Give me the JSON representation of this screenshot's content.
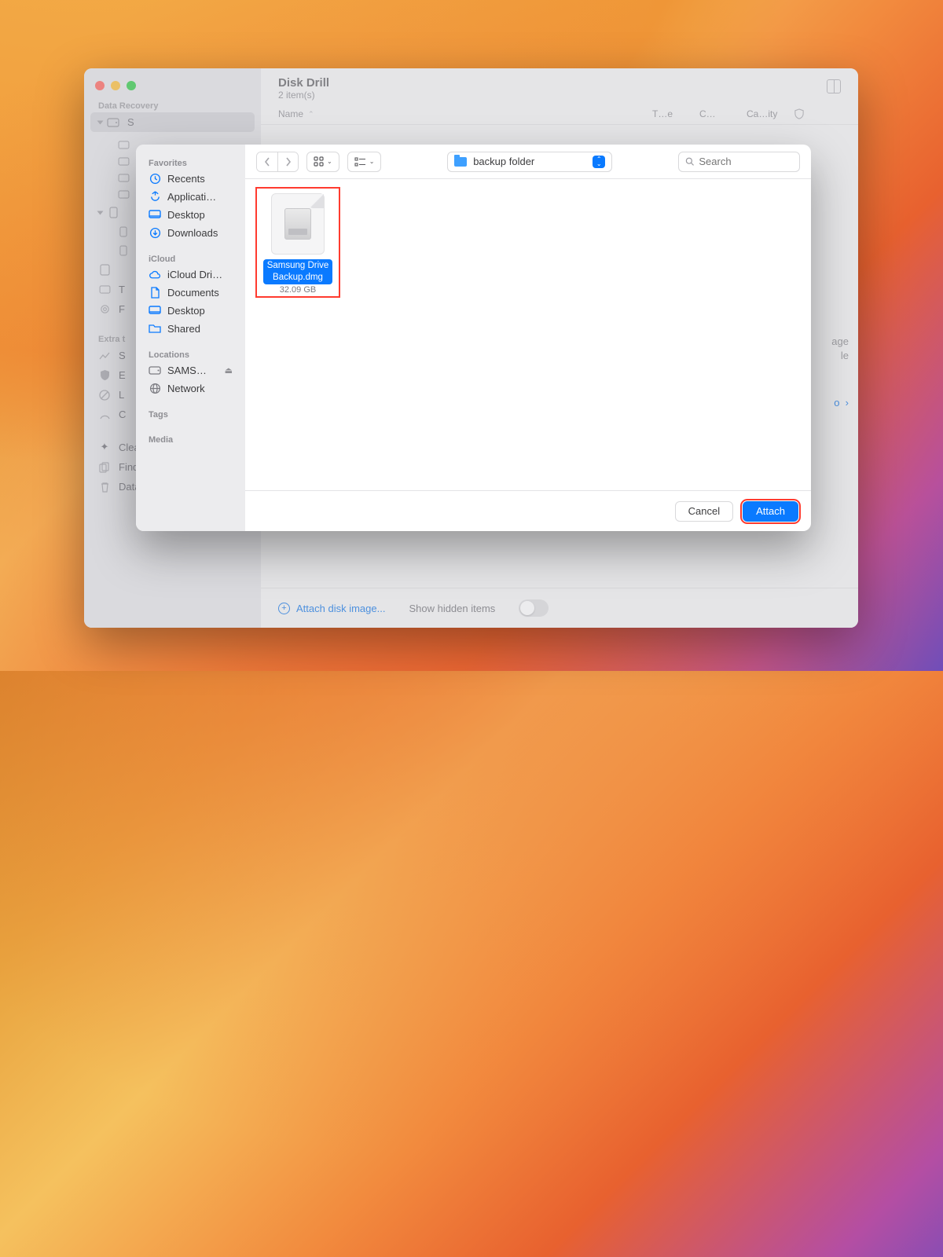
{
  "app": {
    "title": "Disk Drill",
    "subtitle": "2 item(s)",
    "columns": {
      "name": "Name",
      "type": "T…e",
      "cat": "C…",
      "capacity": "Ca…ity"
    },
    "sidebar": {
      "section_recovery": "Data Recovery",
      "item_storage": "S",
      "section_extra": "Extra t",
      "extra_items": [
        "S",
        "E",
        "L",
        "C"
      ],
      "tools": {
        "cleanup": "Clean Up",
        "duplicates": "Find Duplicates",
        "shredder": "Data Shredder"
      }
    },
    "footer": {
      "attach_label": "Attach disk image...",
      "hidden_label": "Show hidden items"
    },
    "peek_right": {
      "line1": "age",
      "line2": "le"
    }
  },
  "dialog": {
    "sidebar": {
      "favorites": "Favorites",
      "items_fav": [
        {
          "icon": "clock",
          "label": "Recents"
        },
        {
          "icon": "app",
          "label": "Applicati…"
        },
        {
          "icon": "desktop",
          "label": "Desktop"
        },
        {
          "icon": "download",
          "label": "Downloads"
        }
      ],
      "icloud": "iCloud",
      "items_icloud": [
        {
          "icon": "cloud",
          "label": "iCloud Dri…"
        },
        {
          "icon": "doc",
          "label": "Documents"
        },
        {
          "icon": "desktop",
          "label": "Desktop"
        },
        {
          "icon": "shared",
          "label": "Shared"
        }
      ],
      "locations": "Locations",
      "items_loc": [
        {
          "icon": "drive",
          "label": "SAMS…",
          "eject": true
        },
        {
          "icon": "globe",
          "label": "Network"
        }
      ],
      "tags": "Tags",
      "media": "Media"
    },
    "location_label": "backup folder",
    "search_placeholder": "Search",
    "file": {
      "name_line1": "Samsung Drive",
      "name_line2": "Backup.dmg",
      "size": "32.09 GB"
    },
    "buttons": {
      "cancel": "Cancel",
      "attach": "Attach"
    }
  }
}
